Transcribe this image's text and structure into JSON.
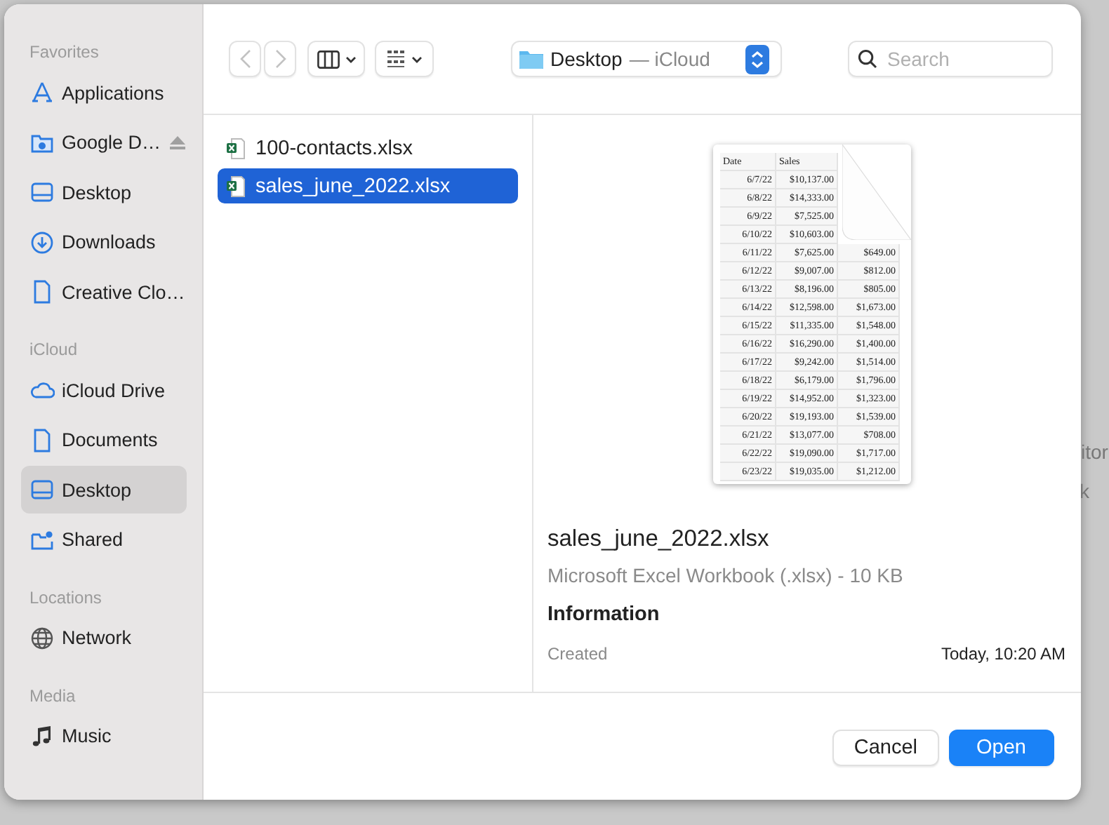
{
  "sidebar": {
    "sections": [
      {
        "title": "Favorites",
        "items": [
          {
            "label": "Applications",
            "selected": false,
            "eject": false
          },
          {
            "label": "Google D…",
            "selected": false,
            "eject": true
          },
          {
            "label": "Desktop",
            "selected": false,
            "eject": false
          },
          {
            "label": "Downloads",
            "selected": false,
            "eject": false
          },
          {
            "label": "Creative Clo…",
            "selected": false,
            "eject": false
          }
        ]
      },
      {
        "title": "iCloud",
        "items": [
          {
            "label": "iCloud Drive",
            "selected": false,
            "eject": false
          },
          {
            "label": "Documents",
            "selected": false,
            "eject": false
          },
          {
            "label": "Desktop",
            "selected": true,
            "eject": false
          },
          {
            "label": "Shared",
            "selected": false,
            "eject": false
          }
        ]
      },
      {
        "title": "Locations",
        "items": [
          {
            "label": "Network",
            "selected": false,
            "eject": false
          }
        ]
      },
      {
        "title": "Media",
        "items": [
          {
            "label": "Music",
            "selected": false,
            "eject": false
          }
        ]
      }
    ]
  },
  "toolbar": {
    "location": {
      "folder": "Desktop",
      "place": "— iCloud"
    },
    "search": {
      "placeholder": "Search"
    }
  },
  "files": [
    {
      "name": "100-contacts.xlsx",
      "selected": false
    },
    {
      "name": "sales_june_2022.xlsx",
      "selected": true
    }
  ],
  "preview": {
    "thumbnail": {
      "header": [
        "Date",
        "Sales"
      ],
      "rows": [
        [
          "6/7/22",
          "$10,137.00"
        ],
        [
          "6/8/22",
          "$14,333.00"
        ],
        [
          "6/9/22",
          "$7,525.00"
        ],
        [
          "6/10/22",
          "$10,603.00"
        ],
        [
          "6/11/22",
          "$7,625.00",
          "$649.00"
        ],
        [
          "6/12/22",
          "$9,007.00",
          "$812.00"
        ],
        [
          "6/13/22",
          "$8,196.00",
          "$805.00"
        ],
        [
          "6/14/22",
          "$12,598.00",
          "$1,673.00"
        ],
        [
          "6/15/22",
          "$11,335.00",
          "$1,548.00"
        ],
        [
          "6/16/22",
          "$16,290.00",
          "$1,400.00"
        ],
        [
          "6/17/22",
          "$9,242.00",
          "$1,514.00"
        ],
        [
          "6/18/22",
          "$6,179.00",
          "$1,796.00"
        ],
        [
          "6/19/22",
          "$14,952.00",
          "$1,323.00"
        ],
        [
          "6/20/22",
          "$19,193.00",
          "$1,539.00"
        ],
        [
          "6/21/22",
          "$13,077.00",
          "$708.00"
        ],
        [
          "6/22/22",
          "$19,090.00",
          "$1,717.00"
        ],
        [
          "6/23/22",
          "$19,035.00",
          "$1,212.00"
        ]
      ]
    },
    "name": "sales_june_2022.xlsx",
    "kind": "Microsoft Excel Workbook (.xlsx) - 10 KB",
    "section": "Information",
    "fields": [
      {
        "label": "Created",
        "value": "Today, 10:20 AM"
      }
    ]
  },
  "buttons": [
    {
      "label": "Cancel",
      "kind": "secondary"
    },
    {
      "label": "Open",
      "kind": "primary"
    }
  ],
  "background": {
    "fragments": [
      "itor",
      "k"
    ]
  }
}
